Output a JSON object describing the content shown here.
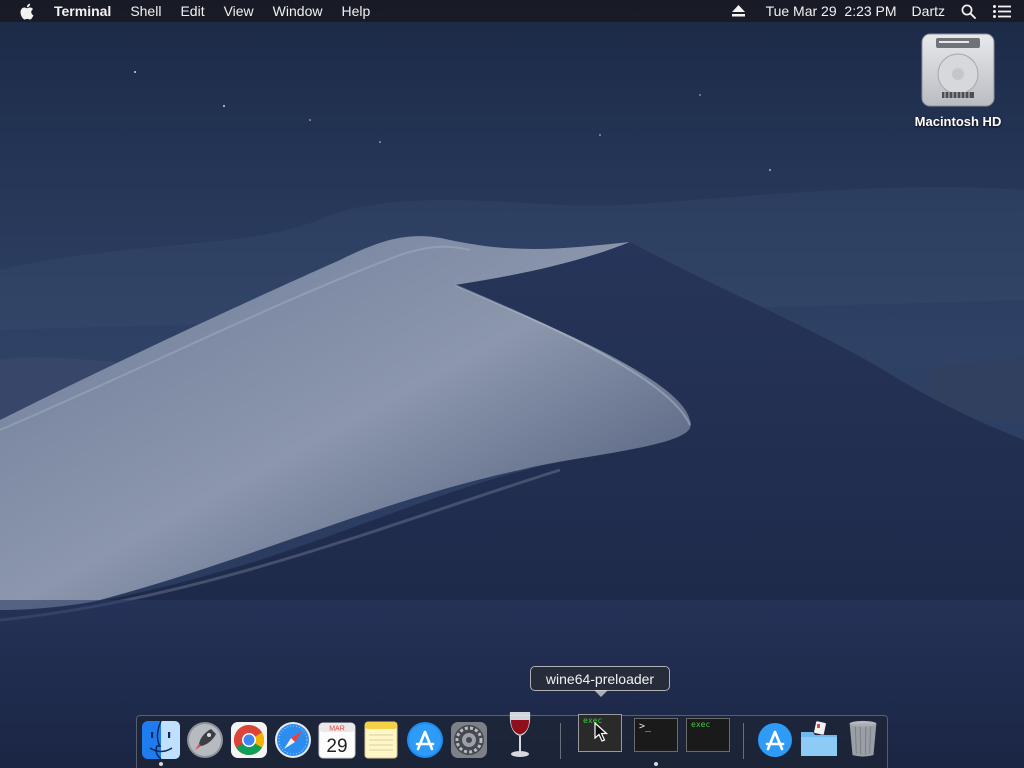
{
  "menubar": {
    "apple_icon": "apple-logo-icon",
    "app_name": "Terminal",
    "items": [
      "Shell",
      "Edit",
      "View",
      "Window",
      "Help"
    ],
    "status": {
      "eject_icon": "eject-icon",
      "clock": "Tue Mar 29  2:23 PM",
      "user": "Dartz",
      "spotlight_icon": "spotlight-search-icon",
      "notification_icon": "notification-center-icon"
    }
  },
  "desktop": {
    "icons": [
      {
        "label": "Macintosh HD",
        "icon": "hard-drive-icon"
      }
    ]
  },
  "tooltip": {
    "text": "wine64-preloader"
  },
  "dock": {
    "apps": [
      {
        "name": "Finder",
        "icon": "finder-icon",
        "running": true
      },
      {
        "name": "Launchpad",
        "icon": "launchpad-icon",
        "running": false
      },
      {
        "name": "Google Chrome",
        "icon": "chrome-icon",
        "running": false
      },
      {
        "name": "Safari",
        "icon": "safari-icon",
        "running": false
      },
      {
        "name": "Calendar",
        "icon": "calendar-icon",
        "running": false,
        "month": "MAR",
        "day": "29"
      },
      {
        "name": "Notes",
        "icon": "notes-icon",
        "running": false
      },
      {
        "name": "App Store",
        "icon": "app-store-icon",
        "running": false
      },
      {
        "name": "System Preferences",
        "icon": "system-preferences-icon",
        "running": false
      },
      {
        "name": "Wine",
        "icon": "wine-glass-icon",
        "running": false
      }
    ],
    "windows": [
      {
        "label": "exec",
        "kind": "terminal-thumbnail",
        "active": true
      },
      {
        "label": ">_",
        "kind": "terminal-thumbnail",
        "active": false,
        "running": true
      },
      {
        "label": "exec",
        "kind": "terminal-thumbnail",
        "active": false
      }
    ],
    "others": [
      {
        "name": "Applications",
        "icon": "applications-folder-icon"
      },
      {
        "name": "Downloads",
        "icon": "downloads-folder-icon"
      },
      {
        "name": "Trash",
        "icon": "trash-icon"
      }
    ]
  },
  "colors": {
    "menubar_bg": "#19191e",
    "terminal_green": "#3fc83f"
  }
}
